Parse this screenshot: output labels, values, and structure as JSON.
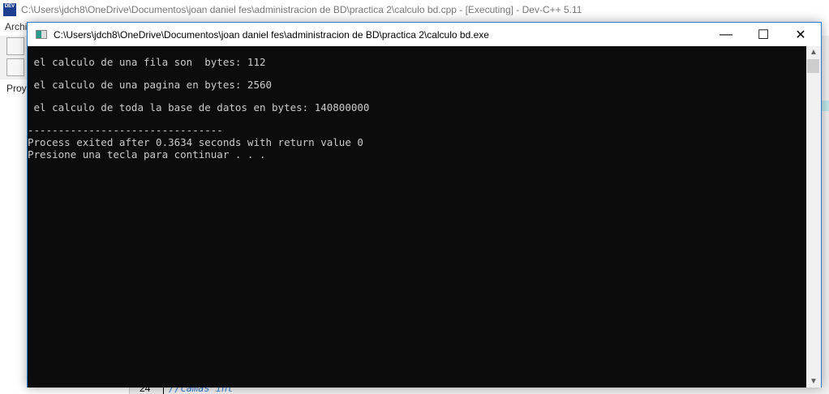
{
  "background_ide": {
    "title": "C:\\Users\\jdch8\\OneDrive\\Documentos\\joan daniel fes\\administracion de BD\\practica 2\\calculo bd.cpp - [Executing] - Dev-C++ 5.11",
    "logo_text": "DEV C++",
    "menu_partial": "Archi",
    "panel_tab_partial": "Proy",
    "line_number": "24",
    "code_line": "//camas int"
  },
  "console": {
    "title": "C:\\Users\\jdch8\\OneDrive\\Documentos\\joan daniel fes\\administracion de BD\\practica 2\\calculo bd.exe",
    "lines": [
      " el calculo de una fila son  bytes: 112",
      " el calculo de una pagina en bytes: 2560",
      " el calculo de toda la base de datos en bytes: 140800000",
      "--------------------------------",
      "Process exited after 0.3634 seconds with return value 0",
      "Presione una tecla para continuar . . ."
    ],
    "buttons": {
      "minimize": "—",
      "maximize": "☐",
      "close": "✕"
    }
  }
}
